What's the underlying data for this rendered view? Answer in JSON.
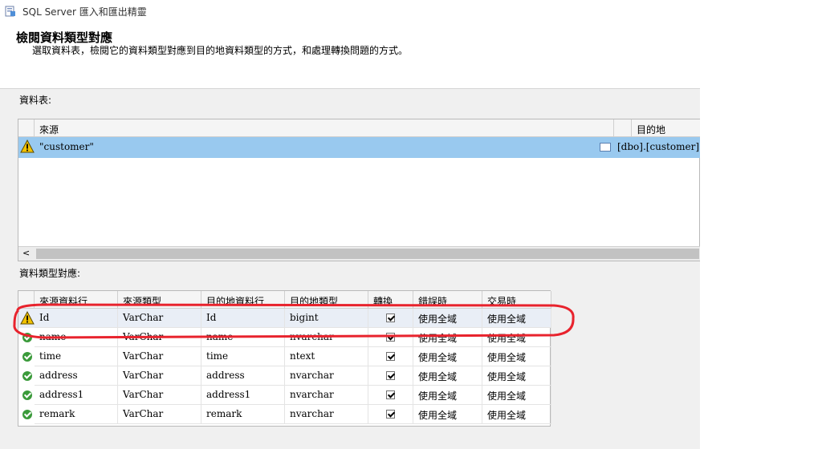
{
  "window": {
    "title": "SQL Server 匯入和匯出精靈"
  },
  "header": {
    "title": "檢閱資料類型對應",
    "subtitle": "選取資料表，檢閱它的資料類型對應到目的地資料類型的方式，和處理轉換問題的方式。"
  },
  "tables_section": {
    "label": "資料表:",
    "columns": {
      "source": "來源",
      "destination": "目的地"
    },
    "rows": [
      {
        "source": "\"customer\"",
        "destination": "[dbo].[customer]",
        "status": "warning"
      }
    ],
    "scroll_left_glyph": "<"
  },
  "mapping_section": {
    "label": "資料類型對應:",
    "columns": [
      "來源資料行",
      "來源類型",
      "目的地資料行",
      "目的地類型",
      "轉換",
      "錯誤時",
      "交易時"
    ],
    "rows": [
      {
        "status": "warning",
        "source_column": "Id",
        "source_type": "VarChar",
        "dest_column": "Id",
        "dest_type": "bigint",
        "convert": true,
        "on_error": "使用全域",
        "on_truncate": "使用全域"
      },
      {
        "status": "ok",
        "source_column": "name",
        "source_type": "VarChar",
        "dest_column": "name",
        "dest_type": "nvarchar",
        "convert": true,
        "on_error": "使用全域",
        "on_truncate": "使用全域"
      },
      {
        "status": "ok",
        "source_column": "time",
        "source_type": "VarChar",
        "dest_column": "time",
        "dest_type": "ntext",
        "convert": true,
        "on_error": "使用全域",
        "on_truncate": "使用全域"
      },
      {
        "status": "ok",
        "source_column": "address",
        "source_type": "VarChar",
        "dest_column": "address",
        "dest_type": "nvarchar",
        "convert": true,
        "on_error": "使用全域",
        "on_truncate": "使用全域"
      },
      {
        "status": "ok",
        "source_column": "address1",
        "source_type": "VarChar",
        "dest_column": "address1",
        "dest_type": "nvarchar",
        "convert": true,
        "on_error": "使用全域",
        "on_truncate": "使用全域"
      },
      {
        "status": "ok",
        "source_column": "remark",
        "source_type": "VarChar",
        "dest_column": "remark",
        "dest_type": "nvarchar",
        "convert": true,
        "on_error": "使用全域",
        "on_truncate": "使用全域"
      }
    ]
  },
  "annotation": {
    "color": "#e8232d",
    "highlights": "first mapping row (Id)"
  },
  "colors": {
    "selection": "#99c9ef",
    "warning": "#f2c200",
    "ok": "#3a9a3a"
  }
}
